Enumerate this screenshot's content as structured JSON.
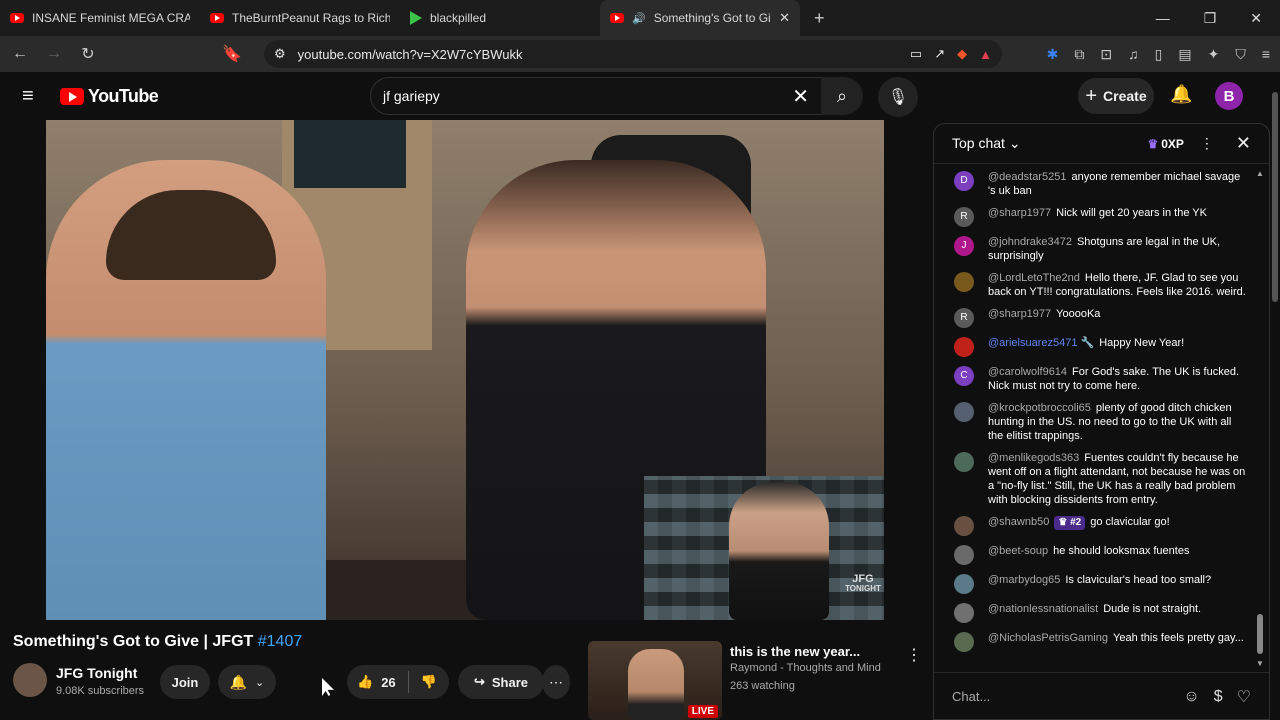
{
  "browser": {
    "tabs": [
      {
        "title": "INSANE Feminist MEGA CRASHOUT !",
        "icon": "youtube-icon"
      },
      {
        "title": "TheBurntPeanut Rags to Riches | ARC",
        "icon": "youtube-icon"
      },
      {
        "title": "blackpilled",
        "icon": "play-icon"
      },
      {
        "title": "Something's Got to Give | JFG",
        "icon": "youtube-icon",
        "active": true
      }
    ],
    "url": "youtube.com/watch?v=X2W7cYBWukk"
  },
  "youtube": {
    "logo_text": "YouTube",
    "search_value": "jf gariepy",
    "create_label": "Create",
    "avatar_letter": "B"
  },
  "video": {
    "title": "Something's Got to Give | JFGT",
    "hashtag": "#1407",
    "watermark_line1": "JFG",
    "watermark_line2": "TONIGHT",
    "channel_name": "JFG Tonight",
    "subscribers": "9.08K subscribers",
    "join_label": "Join",
    "likes": "26",
    "share_label": "Share"
  },
  "recommended": {
    "title": "this is the new year...",
    "channel": "Raymond - Thoughts and Mind",
    "watching": "263 watching",
    "badge": "LIVE"
  },
  "chat": {
    "header": "Top chat",
    "xp": "0XP",
    "input_placeholder": "Chat...",
    "messages": [
      {
        "author": "@deadstar5251",
        "text": "anyone remember michael savage 's uk ban",
        "avatar": "D",
        "color": "#7b3fbf"
      },
      {
        "author": "@sharp1977",
        "text": "Nick will get 20 years in the YK",
        "avatar": "R",
        "color": "#5a5a5a"
      },
      {
        "author": "@johndrake3472",
        "text": "Shotguns are legal in the UK, surprisingly",
        "avatar": "J",
        "color": "#b0178c"
      },
      {
        "author": "@LordLetoThe2nd",
        "text": "Hello there, JF. Glad to see you back on YT!!! congratulations. Feels like 2016. weird.",
        "avatar": "",
        "color": "#7a5a1c"
      },
      {
        "author": "@sharp1977",
        "text": "YooooKa",
        "avatar": "R",
        "color": "#5a5a5a"
      },
      {
        "author": "@arielsuarez5471 🔧",
        "text": "Happy New Year!",
        "avatar": "",
        "color": "#c0221a",
        "moderator": true
      },
      {
        "author": "@carolwolf9614",
        "text": "For God's sake. The UK is fucked. Nick must not try to come here.",
        "avatar": "C",
        "color": "#7b3fbf"
      },
      {
        "author": "@krockpotbroccoli65",
        "text": "plenty of good ditch chicken hunting in the US. no need to go to the UK with all the elitist trappings.",
        "avatar": "",
        "color": "#556070"
      },
      {
        "author": "@menlikegods363",
        "text": "Fuentes couldn't fly because he went off on a flight attendant, not because he was on a \"no-fly list.\" Still, the UK has a really bad problem with blocking dissidents from entry.",
        "avatar": "",
        "color": "#4b6a5a"
      },
      {
        "author": "@shawnb50",
        "text": "go clavicular go!",
        "avatar": "",
        "color": "#6a5040",
        "badge": "#2"
      },
      {
        "author": "@beet-soup",
        "text": "he should looksmax fuentes",
        "avatar": "",
        "color": "#6a6a6a"
      },
      {
        "author": "@marbydog65",
        "text": "Is clavicular's head too small?",
        "avatar": "",
        "color": "#5a7a8a"
      },
      {
        "author": "@nationlessnationalist",
        "text": "Dude is not straight.",
        "avatar": "",
        "color": "#707070"
      },
      {
        "author": "@NicholasPetrisGaming",
        "text": "Yeah this feels pretty gay...",
        "avatar": "",
        "color": "#5a6a50"
      }
    ]
  }
}
